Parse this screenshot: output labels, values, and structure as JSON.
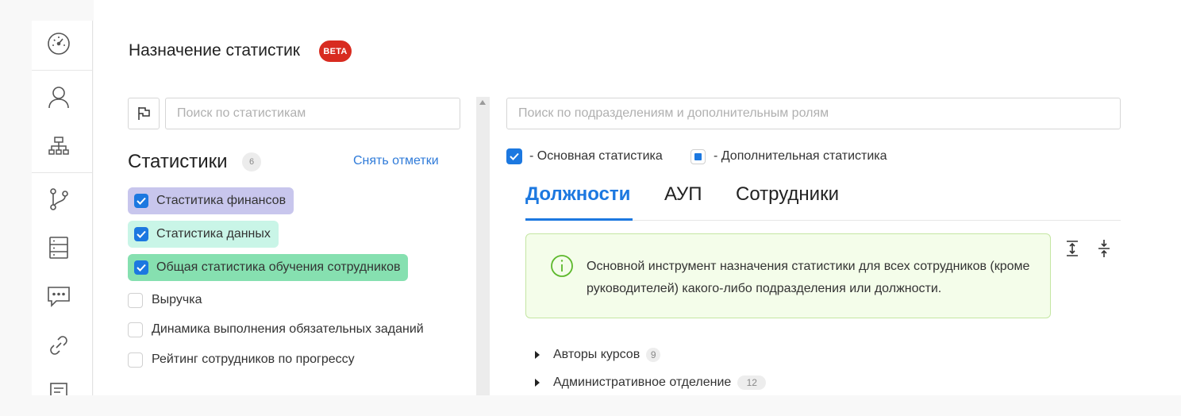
{
  "sidebar": {
    "icons": [
      "dashboard-icon",
      "user-icon",
      "org-structure-icon",
      "branch-icon",
      "list-icon",
      "chat-icon",
      "link-icon",
      "document-icon"
    ]
  },
  "header": {
    "title": "Назначение статистик",
    "badge": "BETA"
  },
  "left_panel": {
    "search_placeholder": "Поиск по статистикам",
    "section_title": "Статистики",
    "count": "6",
    "unmark_label": "Снять отметки",
    "items": [
      {
        "label": "Стаститика финансов",
        "checked": true,
        "color": "#c8c6ed"
      },
      {
        "label": "Статистика данных",
        "checked": true,
        "color": "#c9f5e7"
      },
      {
        "label": "Общая статистика обучения сотрудников",
        "checked": true,
        "color": "#86e0b0"
      },
      {
        "label": "Выручка",
        "checked": false
      },
      {
        "label": "Динамика выполнения обязательных заданий",
        "checked": false
      },
      {
        "label": "Рейтинг сотрудников по прогрессу",
        "checked": false
      }
    ]
  },
  "right_panel": {
    "search_placeholder": "Поиск по подразделениям и дополнительным ролям",
    "legend": {
      "primary": "- Основная статистика",
      "secondary": "- Дополнительная статистика"
    },
    "tabs": [
      {
        "label": "Должности",
        "active": true
      },
      {
        "label": "АУП",
        "active": false
      },
      {
        "label": "Сотрудники",
        "active": false
      }
    ],
    "info": "Основной инструмент назначения статистики для всех сотрудников (кроме руководителей) какого-либо подразделения или должности.",
    "tree": [
      {
        "label": "Авторы курсов",
        "count": "9"
      },
      {
        "label": "Административное отделение",
        "count": "12"
      }
    ]
  },
  "colors": {
    "accent": "#1c78e0",
    "beta": "#d82b20",
    "info_bg": "#f4fdea",
    "info_border": "#c4e6a3",
    "info_icon": "#5cb82b"
  }
}
